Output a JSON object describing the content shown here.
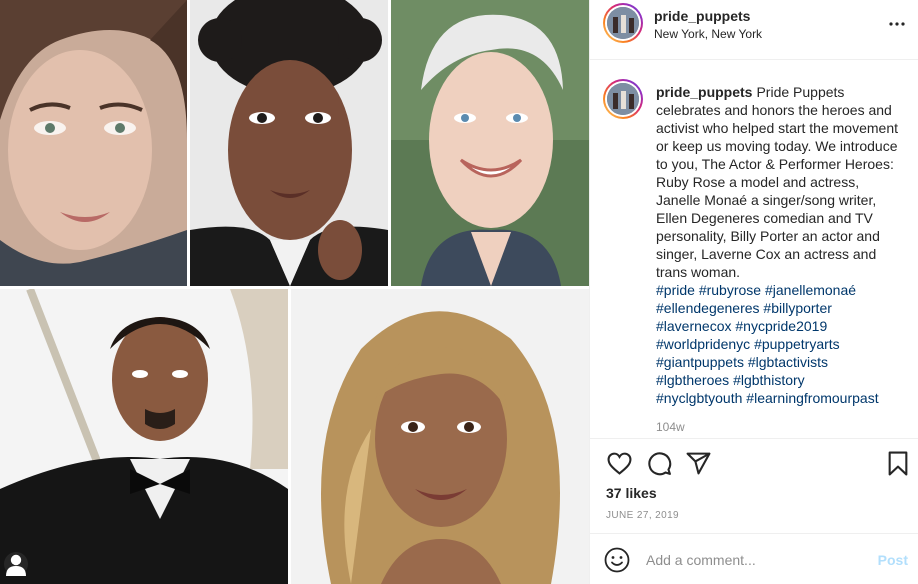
{
  "post": {
    "username": "pride_puppets",
    "location": "New York, New York"
  },
  "caption": {
    "username": "pride_puppets",
    "text": "Pride Puppets celebrates and honors the heroes and activist who helped start the movement or keep us moving today. We introduce to you, The Actor & Performer Heroes: Ruby Rose a model and actress, Janelle Monaé a singer/song writer, Ellen Degeneres comedian and TV personality, Billy Porter an actor and singer, Laverne Cox an actress and trans woman.",
    "hashtags": [
      "#pride",
      "#rubyrose",
      "#janellemonaé",
      "#ellendegeneres",
      "#billyporter",
      "#lavernecox",
      "#nycpride2019",
      "#worldpridenyc",
      "#puppetryarts",
      "#giantpuppets",
      "#lgbtactivists",
      "#lgbtheroes",
      "#lgbthistory",
      "#nyclgbtyouth",
      "#learningfromourpast"
    ],
    "age": "104w"
  },
  "engagement": {
    "likes": "37 likes",
    "date": "JUNE 27, 2019"
  },
  "comment": {
    "placeholder": "Add a comment...",
    "post_label": "Post"
  },
  "icons": {
    "more": "more-horizontal-icon",
    "like": "heart-icon",
    "comment": "comment-bubble-icon",
    "share": "paper-plane-icon",
    "save": "bookmark-icon",
    "emoji": "smiley-icon",
    "tagged": "user-tag-icon"
  },
  "colors": {
    "link": "#00376b",
    "muted": "#8e8e8e",
    "post_disabled": "#b2dffc",
    "border": "#efefef"
  }
}
